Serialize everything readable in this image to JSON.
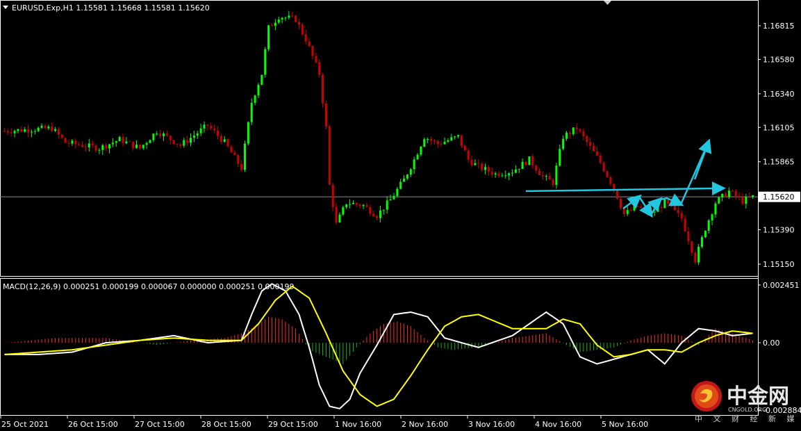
{
  "window": {
    "symbol_header": "EURUSD.Exp,H1  1.15581 1.15668 1.15581 1.15620",
    "current_price_label": "1.15620"
  },
  "macd_header": "MACD(12,26,9) 0.000251 0.000199 0.000067 0.000000 0.000251 0.000199",
  "watermark": {
    "brand": "中金网",
    "domain": "CNGOLD.ORG",
    "tagline": "中 文 财 经 新 媒 体"
  },
  "colors": {
    "background": "#000000",
    "bull": "#00ff00",
    "bear": "#cc0000",
    "macd_line": "#ffffff",
    "signal_line": "#ffff00",
    "hist_pos": "#ff2a2a",
    "hist_neg": "#0cbb0c",
    "annotation": "#22c6de",
    "grid_axis": "#ffffff"
  },
  "chart_data": [
    {
      "type": "candlestick",
      "title": "EURUSD.Exp,H1",
      "ohlc_header": [
        "1.15581",
        "1.15668",
        "1.15581",
        "1.15620"
      ],
      "y_ticks": [
        "1.16815",
        "1.16580",
        "1.16340",
        "1.16105",
        "1.15865",
        "1.15620",
        "1.15390",
        "1.15150"
      ],
      "ylim": [
        1.1507,
        1.1702
      ],
      "x_ticks": [
        "25 Oct 2021",
        "26 Oct 15:00",
        "27 Oct 15:00",
        "28 Oct 15:00",
        "29 Oct 15:00",
        "1 Nov 16:00",
        "2 Nov 16:00",
        "3 Nov 16:00",
        "4 Nov 16:00",
        "5 Nov 16:00"
      ],
      "current_price": 1.1562,
      "close_path_anchors": [
        [
          0,
          1.1608
        ],
        [
          14,
          1.161
        ],
        [
          18,
          1.16
        ],
        [
          28,
          1.1596
        ],
        [
          34,
          1.1602
        ],
        [
          40,
          1.1596
        ],
        [
          45,
          1.1608
        ],
        [
          52,
          1.1598
        ],
        [
          60,
          1.1612
        ],
        [
          65,
          1.16
        ],
        [
          70,
          1.1582
        ],
        [
          73,
          1.1628
        ],
        [
          76,
          1.1648
        ],
        [
          78,
          1.168
        ],
        [
          81,
          1.1688
        ],
        [
          86,
          1.1686
        ],
        [
          89,
          1.1672
        ],
        [
          93,
          1.1648
        ],
        [
          95,
          1.161
        ],
        [
          96,
          1.157
        ],
        [
          98,
          1.1543
        ],
        [
          101,
          1.1558
        ],
        [
          106,
          1.1556
        ],
        [
          110,
          1.1549
        ],
        [
          114,
          1.156
        ],
        [
          118,
          1.1574
        ],
        [
          121,
          1.1588
        ],
        [
          124,
          1.1604
        ],
        [
          128,
          1.1599
        ],
        [
          134,
          1.1604
        ],
        [
          137,
          1.1588
        ],
        [
          140,
          1.1583
        ],
        [
          145,
          1.1578
        ],
        [
          150,
          1.158
        ],
        [
          155,
          1.1588
        ],
        [
          159,
          1.1576
        ],
        [
          162,
          1.1572
        ],
        [
          165,
          1.1604
        ],
        [
          169,
          1.161
        ],
        [
          172,
          1.16
        ],
        [
          176,
          1.1586
        ],
        [
          180,
          1.1568
        ],
        [
          183,
          1.155
        ],
        [
          187,
          1.1555
        ],
        [
          191,
          1.155
        ],
        [
          195,
          1.1558
        ],
        [
          200,
          1.1547
        ],
        [
          204,
          1.1518
        ],
        [
          207,
          1.154
        ],
        [
          210,
          1.1558
        ],
        [
          214,
          1.1566
        ],
        [
          218,
          1.1559
        ],
        [
          221,
          1.1562
        ]
      ]
    },
    {
      "type": "line+histogram",
      "title": "MACD(12,26,9)",
      "values_header": [
        "0.000251",
        "0.000199",
        "0.000067",
        "0.000000",
        "0.000251",
        "0.000199"
      ],
      "y_ticks": [
        "0.002451",
        "0.00",
        "-0.002884"
      ],
      "ylim": [
        -0.002884,
        0.002451
      ],
      "series": [
        {
          "name": "MACD",
          "x": [
            0,
            10,
            20,
            30,
            40,
            50,
            60,
            70,
            73,
            76,
            79,
            83,
            87,
            90,
            93,
            96,
            99,
            102,
            105,
            110,
            115,
            120,
            125,
            130,
            140,
            150,
            160,
            165,
            170,
            175,
            180,
            185,
            190,
            195,
            200,
            205,
            210,
            215,
            221
          ],
          "y": [
            -0.0005,
            -0.0005,
            -0.0004,
            0.0,
            0.0001,
            0.0003,
            0.0,
            0.0001,
            0.0012,
            0.0022,
            0.0025,
            0.0022,
            0.0012,
            -0.0002,
            -0.0018,
            -0.0027,
            -0.0028,
            -0.0024,
            -0.0013,
            -0.0001,
            0.0012,
            0.0013,
            0.0011,
            0.0002,
            -0.0002,
            0.0003,
            0.0013,
            0.0008,
            -0.0006,
            -0.0009,
            -0.0007,
            -0.0005,
            -0.0003,
            -0.0009,
            0.0,
            0.0006,
            0.0005,
            0.0003,
            0.0004
          ]
        },
        {
          "name": "Signal",
          "x": [
            0,
            10,
            20,
            30,
            40,
            50,
            60,
            70,
            75,
            80,
            85,
            90,
            95,
            100,
            105,
            110,
            115,
            120,
            125,
            130,
            135,
            140,
            150,
            160,
            165,
            170,
            175,
            180,
            185,
            190,
            195,
            200,
            205,
            210,
            215,
            221
          ],
          "y": [
            -0.0005,
            -0.0004,
            -0.0003,
            -0.0001,
            0.0001,
            0.0002,
            0.0001,
            0.0001,
            0.0008,
            0.0018,
            0.0024,
            0.0019,
            0.0004,
            -0.0012,
            -0.0022,
            -0.0027,
            -0.0024,
            -0.0014,
            -0.0003,
            0.0007,
            0.0011,
            0.0012,
            0.0006,
            0.0006,
            0.001,
            0.0008,
            -0.0001,
            -0.0006,
            -0.0005,
            -0.0003,
            -0.0003,
            -0.0004,
            0.0,
            0.0003,
            0.0005,
            0.0004
          ]
        },
        {
          "name": "Histogram",
          "x": [
            0,
            15,
            30,
            45,
            55,
            65,
            70,
            74,
            78,
            82,
            86,
            90,
            95,
            100,
            104,
            108,
            112,
            116,
            120,
            124,
            128,
            132,
            140,
            150,
            160,
            166,
            170,
            175,
            180,
            185,
            190,
            195,
            200,
            205,
            210,
            215,
            221
          ],
          "y": [
            0.0,
            0.0002,
            0.0002,
            -0.0001,
            0.0001,
            0.0002,
            0.0004,
            0.0007,
            0.0011,
            0.001,
            0.0006,
            -0.0003,
            -0.0006,
            -0.0009,
            -0.0002,
            0.0004,
            0.0008,
            0.0009,
            0.0007,
            0.0002,
            -0.0002,
            -0.0003,
            -0.0002,
            0.0002,
            0.0004,
            -0.0001,
            -0.0004,
            -0.0003,
            -0.0002,
            0.0001,
            0.0003,
            0.0004,
            0.0003,
            -0.0001,
            0.0006,
            0.0004,
            0.0001
          ]
        }
      ]
    }
  ],
  "annotations": {
    "description": "cyan trendline and projected path arrows",
    "trendline_price": [
      1.1566,
      1.1568
    ]
  }
}
